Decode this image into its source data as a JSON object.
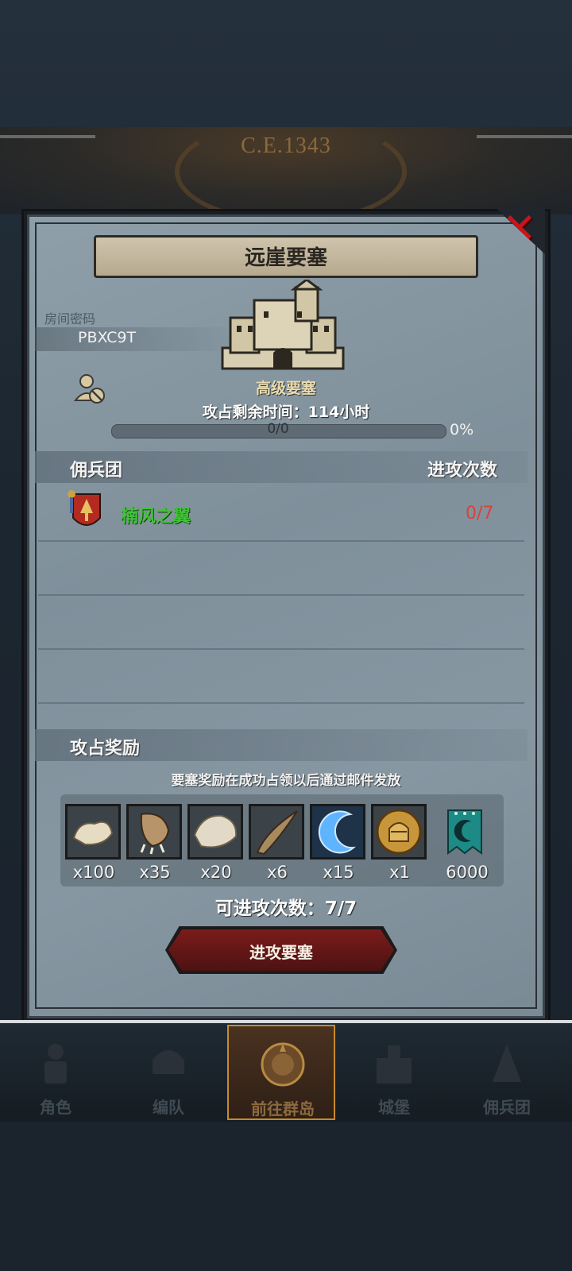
{
  "header": {
    "era": "C.E.1343"
  },
  "dialog": {
    "title": "远崖要塞",
    "room_label": "房间密码",
    "room_code": "PBXC9T",
    "fortress_type": "高级要塞",
    "time_left": "攻占剩余时间：114小时",
    "progress": {
      "text": "0/0",
      "percent_text": "0%",
      "fraction": 0
    },
    "guild_section": {
      "title": "佣兵团",
      "count_header": "进攻次数"
    },
    "guilds": [
      {
        "name": "楠风之翼",
        "attacks": "0/7"
      }
    ],
    "reward_section": {
      "title": "攻占奖励",
      "note": "要塞奖励在成功占领以后通过邮件发放"
    },
    "rewards": [
      {
        "icon": "fur-pelt-icon",
        "qty": "x100"
      },
      {
        "icon": "claw-icon",
        "qty": "x35"
      },
      {
        "icon": "hide-icon",
        "qty": "x20"
      },
      {
        "icon": "horn-icon",
        "qty": "x6"
      },
      {
        "icon": "blue-crescent-icon",
        "qty": "x15"
      },
      {
        "icon": "knight-helmet-coin-icon",
        "qty": "x1"
      },
      {
        "icon": "guild-banner-icon",
        "qty": "6000"
      }
    ],
    "attack_count": "可进攻次数：7/7",
    "attack_button": "进攻要塞"
  },
  "nav": {
    "items": [
      {
        "label": "角色",
        "icon": "knight-icon"
      },
      {
        "label": "编队",
        "icon": "helmet-icon"
      },
      {
        "label": "前往群岛",
        "icon": "compass-icon",
        "active": true
      },
      {
        "label": "城堡",
        "icon": "castle-icon"
      },
      {
        "label": "佣兵团",
        "icon": "mercenary-icon"
      }
    ]
  },
  "colors": {
    "guild_name": "#42c23a",
    "attack_count_red": "#d9423a",
    "close_red": "#c4161c",
    "button_red": "#7a1c1a",
    "active_nav_border": "#c88a2c"
  }
}
